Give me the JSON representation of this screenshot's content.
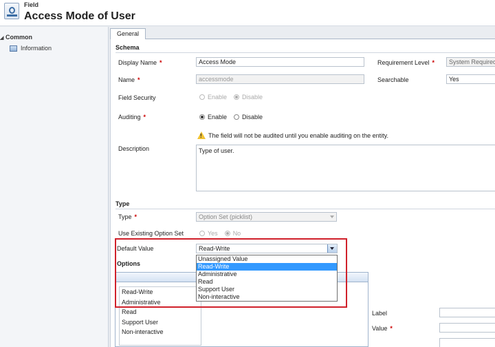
{
  "header": {
    "breadcrumb": "Field",
    "title": "Access Mode of User"
  },
  "nav": {
    "group": "Common",
    "items": [
      {
        "label": "Information"
      }
    ]
  },
  "tabs": [
    {
      "label": "General"
    }
  ],
  "schema": {
    "section_title": "Schema",
    "display_name_label": "Display Name",
    "display_name_value": "Access Mode",
    "requirement_label": "Requirement Level",
    "requirement_value": "System Required",
    "name_label": "Name",
    "name_value": "accessmode",
    "searchable_label": "Searchable",
    "searchable_value": "Yes",
    "field_security_label": "Field Security",
    "field_security_enable": "Enable",
    "field_security_disable": "Disable",
    "auditing_label": "Auditing",
    "auditing_enable": "Enable",
    "auditing_disable": "Disable",
    "audit_warning": "The field will not be audited until you enable auditing on the entity.",
    "description_label": "Description",
    "description_value": "Type of user.",
    "required_marker": "*"
  },
  "type_section": {
    "section_title": "Type",
    "type_label": "Type",
    "type_value": "Option Set (picklist)",
    "use_existing_label": "Use Existing Option Set",
    "use_existing_yes": "Yes",
    "use_existing_no": "No",
    "default_value_label": "Default Value",
    "default_value_selected": "Read-Write",
    "dropdown_options": [
      "Unassigned Value",
      "Read-Write",
      "Administrative",
      "Read",
      "Support User",
      "Non-interactive"
    ],
    "options_title": "Options",
    "options_list": [
      "Read-Write",
      "Administrative",
      "Read",
      "Support User",
      "Non-interactive"
    ],
    "label_label": "Label",
    "value_label": "Value"
  },
  "colors": {
    "highlight": "#d0202a",
    "selection": "#3399ff"
  }
}
